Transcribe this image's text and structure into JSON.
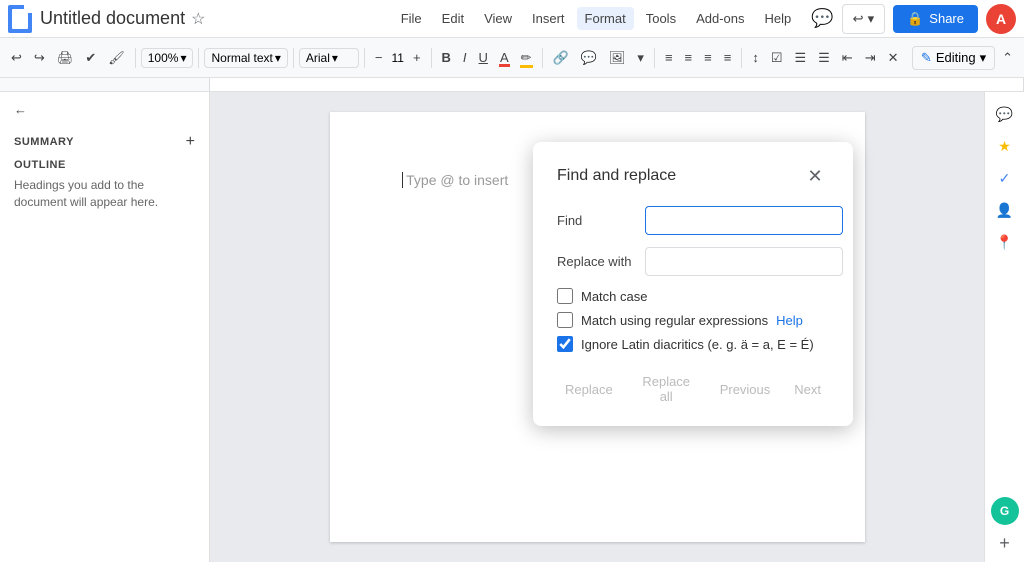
{
  "app": {
    "title": "Untitled document",
    "star_label": "☆"
  },
  "menu": {
    "items": [
      "File",
      "Edit",
      "View",
      "Insert",
      "Format",
      "Tools",
      "Add-ons",
      "Help"
    ]
  },
  "toolbar": {
    "zoom": "100%",
    "font_style": "Normal text",
    "font_name": "Arial",
    "font_size": "11",
    "editing_label": "Editing"
  },
  "sidebar": {
    "back_label": "",
    "summary_label": "SUMMARY",
    "add_label": "+",
    "outline_label": "OUTLINE",
    "hint": "Headings you add to the document will appear here."
  },
  "doc": {
    "placeholder": "Type @ to insert"
  },
  "dialog": {
    "title": "Find and replace",
    "find_label": "Find",
    "replace_label": "Replace with",
    "find_value": "",
    "replace_value": "",
    "match_case_label": "Match case",
    "match_case_checked": false,
    "regex_label": "Match using regular expressions",
    "regex_checked": false,
    "help_label": "Help",
    "diacritics_label": "Ignore Latin diacritics (e. g. ä = a, E = É)",
    "diacritics_checked": true,
    "replace_btn": "Replace",
    "replace_all_btn": "Replace all",
    "previous_btn": "Previous",
    "next_btn": "Next"
  },
  "right_sidebar": {
    "icons": [
      "💬",
      "⬜",
      "✓",
      "👤",
      "📍"
    ]
  },
  "share_btn": "Share",
  "avatar_label": "A"
}
